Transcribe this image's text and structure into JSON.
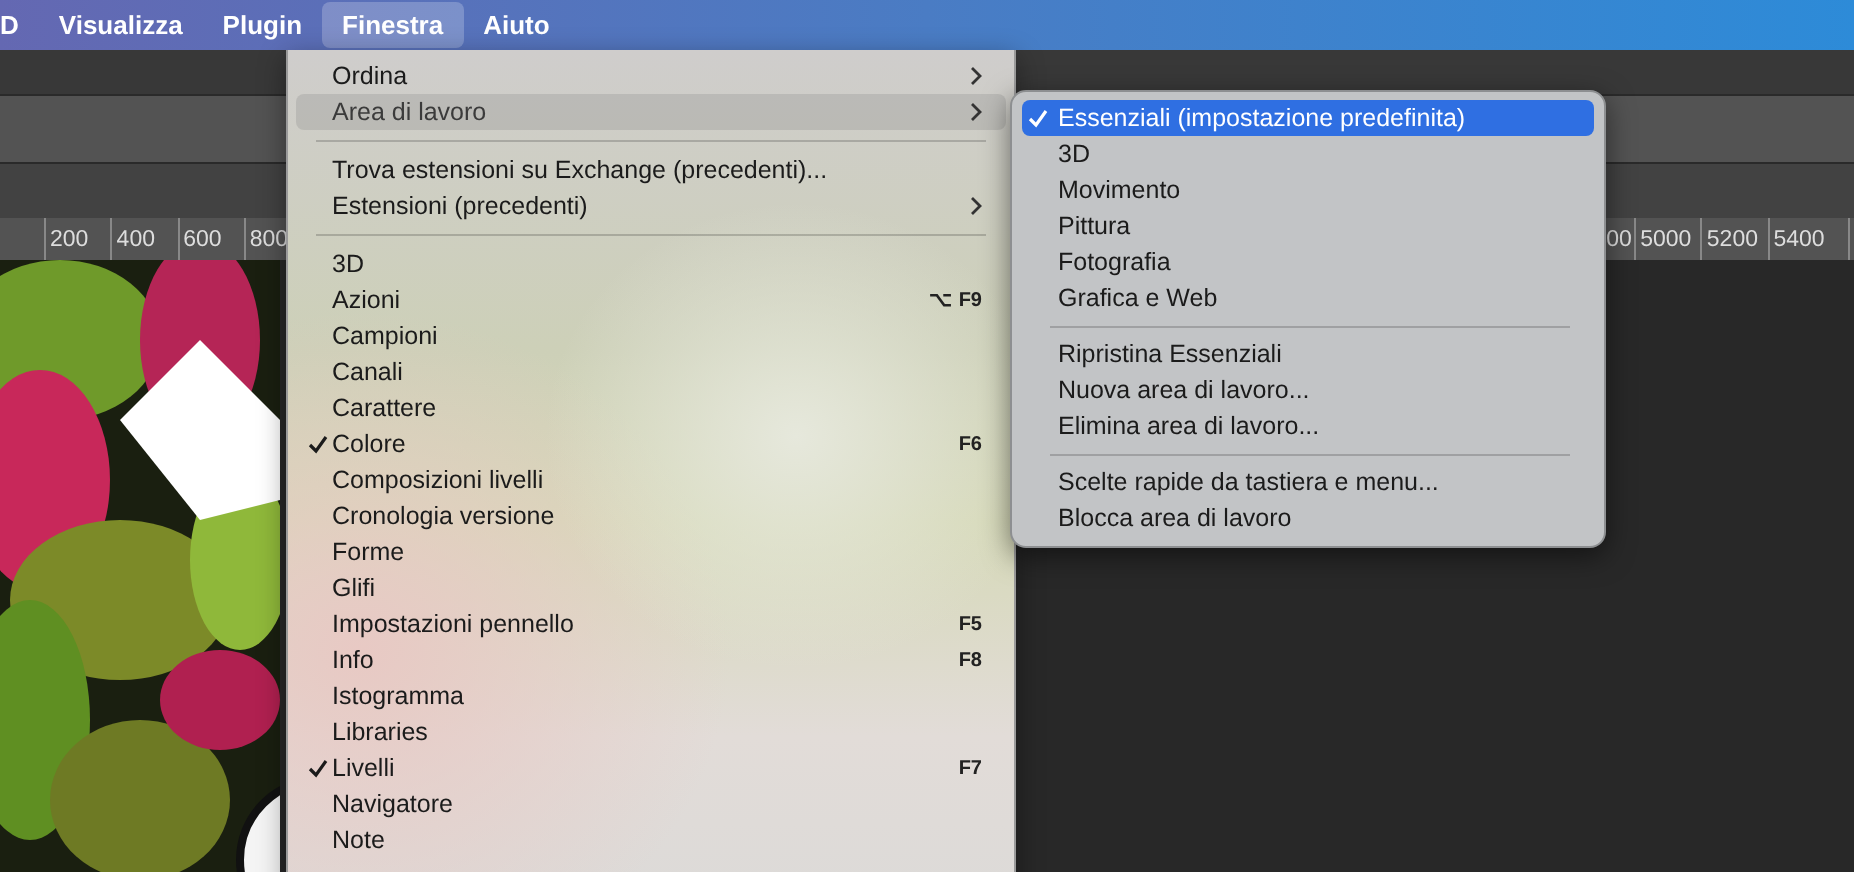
{
  "menu_bar": {
    "items": [
      {
        "label": "D",
        "selected": false
      },
      {
        "label": "Visualizza",
        "selected": false
      },
      {
        "label": "Plugin",
        "selected": false
      },
      {
        "label": "Finestra",
        "selected": true
      },
      {
        "label": "Aiuto",
        "selected": false
      }
    ]
  },
  "ruler": {
    "left_labels": [
      "200",
      "400",
      "600",
      "800"
    ],
    "right_labels": [
      "00",
      "5000",
      "5200",
      "5400"
    ]
  },
  "menu": {
    "items": [
      {
        "kind": "item",
        "label": "Ordina",
        "checked": false,
        "selected": false,
        "has_submenu": true
      },
      {
        "kind": "item",
        "label": "Area di lavoro",
        "checked": false,
        "selected": true,
        "has_submenu": true
      },
      {
        "kind": "separator"
      },
      {
        "kind": "item",
        "label": "Trova estensioni su Exchange (precedenti)...",
        "checked": false,
        "selected": false,
        "has_submenu": false
      },
      {
        "kind": "item",
        "label": "Estensioni (precedenti)",
        "checked": false,
        "selected": false,
        "has_submenu": true
      },
      {
        "kind": "separator"
      },
      {
        "kind": "item",
        "label": "3D",
        "checked": false,
        "selected": false,
        "has_submenu": false
      },
      {
        "kind": "item",
        "label": "Azioni",
        "checked": false,
        "selected": false,
        "has_submenu": false,
        "shortcut": "⌥ F9"
      },
      {
        "kind": "item",
        "label": "Campioni",
        "checked": false,
        "selected": false,
        "has_submenu": false
      },
      {
        "kind": "item",
        "label": "Canali",
        "checked": false,
        "selected": false,
        "has_submenu": false
      },
      {
        "kind": "item",
        "label": "Carattere",
        "checked": false,
        "selected": false,
        "has_submenu": false
      },
      {
        "kind": "item",
        "label": "Colore",
        "checked": true,
        "selected": false,
        "has_submenu": false,
        "shortcut": "F6"
      },
      {
        "kind": "item",
        "label": "Composizioni livelli",
        "checked": false,
        "selected": false,
        "has_submenu": false
      },
      {
        "kind": "item",
        "label": "Cronologia versione",
        "checked": false,
        "selected": false,
        "has_submenu": false
      },
      {
        "kind": "item",
        "label": "Forme",
        "checked": false,
        "selected": false,
        "has_submenu": false
      },
      {
        "kind": "item",
        "label": "Glifi",
        "checked": false,
        "selected": false,
        "has_submenu": false
      },
      {
        "kind": "item",
        "label": "Impostazioni pennello",
        "checked": false,
        "selected": false,
        "has_submenu": false,
        "shortcut": "F5"
      },
      {
        "kind": "item",
        "label": "Info",
        "checked": false,
        "selected": false,
        "has_submenu": false,
        "shortcut": "F8"
      },
      {
        "kind": "item",
        "label": "Istogramma",
        "checked": false,
        "selected": false,
        "has_submenu": false
      },
      {
        "kind": "item",
        "label": "Libraries",
        "checked": false,
        "selected": false,
        "has_submenu": false
      },
      {
        "kind": "item",
        "label": "Livelli",
        "checked": true,
        "selected": false,
        "has_submenu": false,
        "shortcut": "F7"
      },
      {
        "kind": "item",
        "label": "Navigatore",
        "checked": false,
        "selected": false,
        "has_submenu": false
      },
      {
        "kind": "item",
        "label": "Note",
        "checked": false,
        "selected": false,
        "has_submenu": false
      }
    ]
  },
  "submenu": {
    "items": [
      {
        "kind": "item",
        "label": "Essenziali (impostazione predefinita)",
        "checked": true,
        "selected": true
      },
      {
        "kind": "item",
        "label": "3D",
        "checked": false,
        "selected": false
      },
      {
        "kind": "item",
        "label": "Movimento",
        "checked": false,
        "selected": false
      },
      {
        "kind": "item",
        "label": "Pittura",
        "checked": false,
        "selected": false
      },
      {
        "kind": "item",
        "label": "Fotografia",
        "checked": false,
        "selected": false
      },
      {
        "kind": "item",
        "label": "Grafica e Web",
        "checked": false,
        "selected": false
      },
      {
        "kind": "separator"
      },
      {
        "kind": "item",
        "label": "Ripristina Essenziali",
        "checked": false,
        "selected": false
      },
      {
        "kind": "item",
        "label": "Nuova area di lavoro...",
        "checked": false,
        "selected": false
      },
      {
        "kind": "item",
        "label": "Elimina area di lavoro...",
        "checked": false,
        "selected": false
      },
      {
        "kind": "separator"
      },
      {
        "kind": "item",
        "label": "Scelte rapide da tastiera e menu...",
        "checked": false,
        "selected": false
      },
      {
        "kind": "item",
        "label": "Blocca area di lavoro",
        "checked": false,
        "selected": false
      }
    ]
  }
}
